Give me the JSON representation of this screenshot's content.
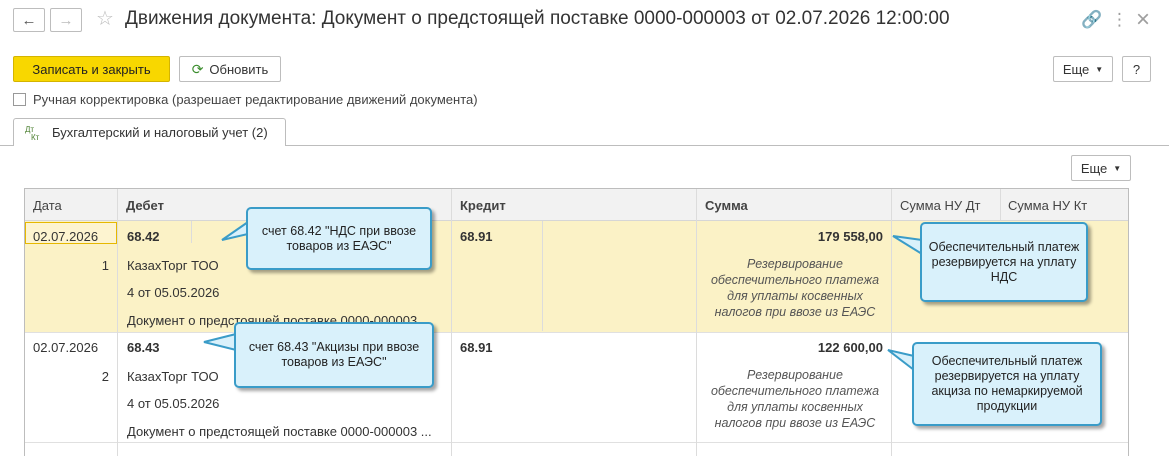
{
  "window": {
    "title": "Движения документа: Документ о предстоящей поставке 0000-000003 от 02.07.2026 12:00:00"
  },
  "toolbar": {
    "save_close_label": "Записать и закрыть",
    "refresh_label": "Обновить",
    "more_label": "Еще",
    "help_label": "?"
  },
  "manual_correction": {
    "label": "Ручная корректировка (разрешает редактирование движений документа)",
    "checked": false
  },
  "tabs": [
    {
      "label": "Бухгалтерский и налоговый учет (2)",
      "icon": "dt-kt-icon",
      "icon_text_top": "Дт",
      "icon_text_bottom": "Кт"
    }
  ],
  "grid": {
    "more_label": "Еще",
    "columns": [
      "Дата",
      "Дебет",
      "Кредит",
      "Сумма",
      "Сумма НУ Дт",
      "Сумма НУ Кт"
    ],
    "rows": [
      {
        "date": "02.07.2026",
        "number": "1",
        "debit_account": "68.42",
        "debit_sub1": "КазахТорг ТОО",
        "debit_sub2": "4 от 05.05.2026",
        "debit_sub3": "Документ о предстоящей поставке 0000-000003 ...",
        "credit_account": "68.91",
        "amount": "179 558,00",
        "description": "Резервирование обеспечительного платежа для уплаты косвенных налогов при ввозе из ЕАЭС"
      },
      {
        "date": "02.07.2026",
        "number": "2",
        "debit_account": "68.43",
        "debit_sub1": "КазахТорг ТОО",
        "debit_sub2": "4 от 05.05.2026",
        "debit_sub3": "Документ о предстоящей поставке 0000-000003 ...",
        "credit_account": "68.91",
        "amount": "122 600,00",
        "description": "Резервирование обеспечительного платежа для уплаты косвенных налогов при ввозе из ЕАЭС"
      }
    ]
  },
  "callouts": {
    "c1": "счет 68.42 \"НДС при ввозе товаров из ЕАЭС\"",
    "c2": "Обеспечительный платеж резервируется на уплату НДС",
    "c3": "счет 68.43 \"Акцизы при ввозе товаров из ЕАЭС\"",
    "c4": "Обеспечительный платеж резервируется на уплату акциза по немаркируемой продукции"
  },
  "colors": {
    "primary_button": "#f8d700",
    "selected_row": "#fbf2c6",
    "callout_fill": "#d9f1fb",
    "callout_border": "#3a9cc8"
  }
}
